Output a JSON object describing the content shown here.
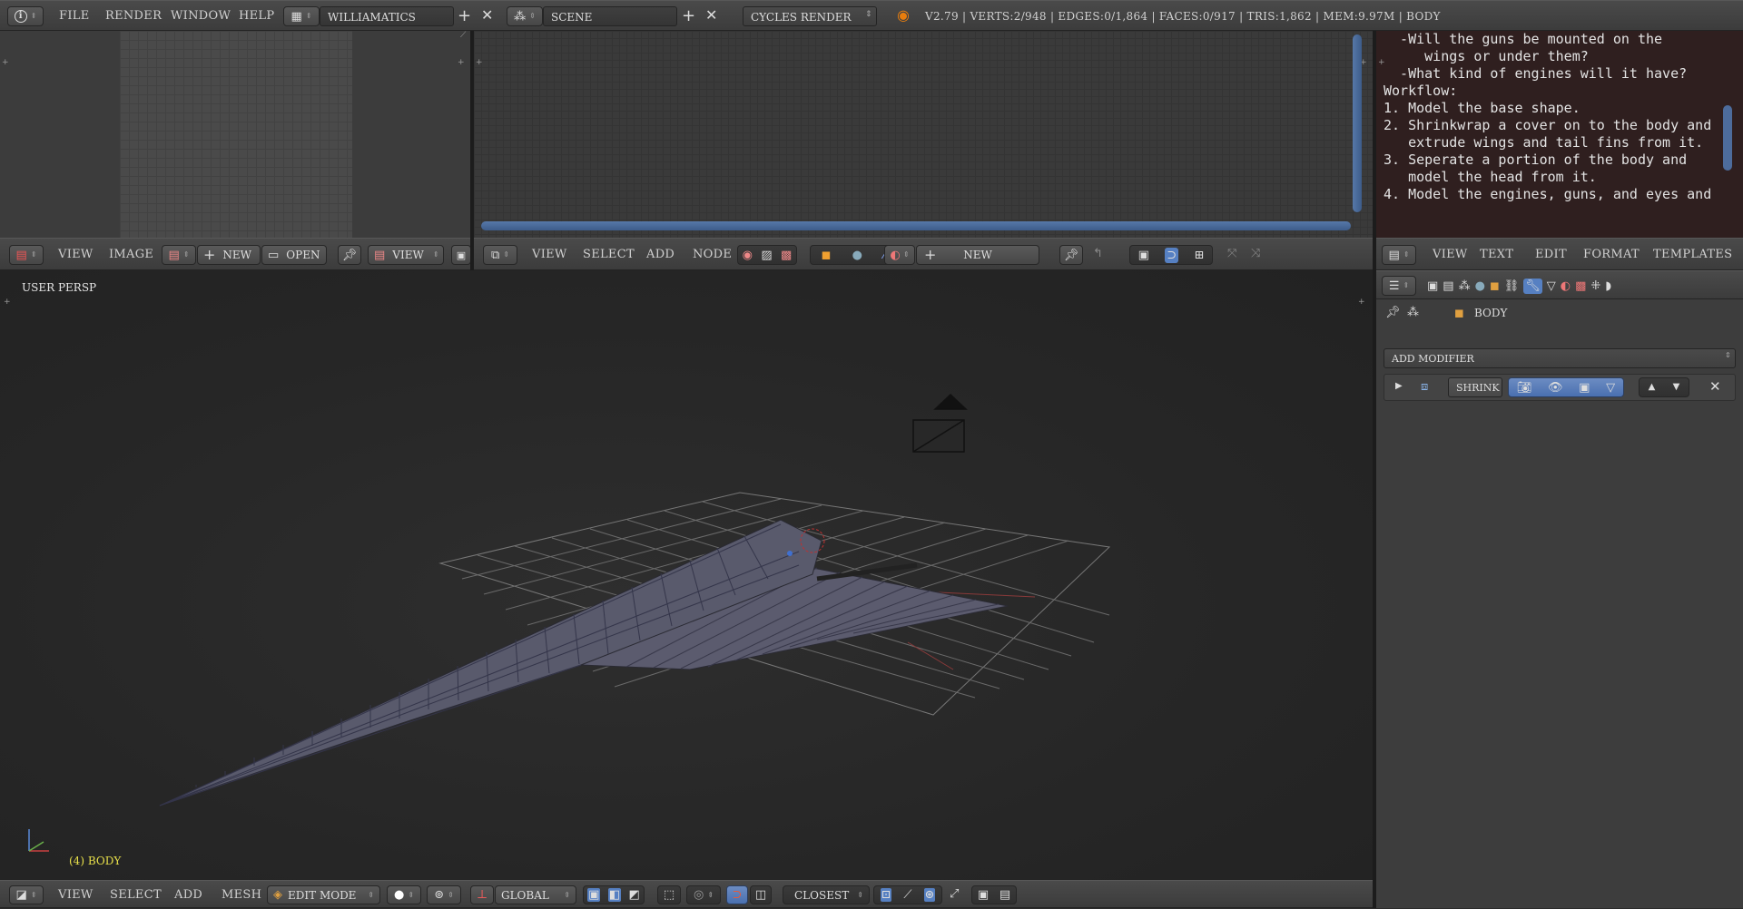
{
  "topbar": {
    "menus": [
      "FILE",
      "RENDER",
      "WINDOW",
      "HELP"
    ],
    "screen_layout": "WILLIAMATICS",
    "scene": "SCENE",
    "render_engine": "CYCLES RENDER",
    "stats": "V2.79 | VERTS:2/948 | EDGES:0/1,864 | FACES:0/917 | TRIS:1,862 | MEM:9.97M | BODY"
  },
  "image_editor": {
    "menus": [
      "VIEW",
      "IMAGE"
    ],
    "new_label": "NEW",
    "open_label": "OPEN",
    "view_label": "VIEW"
  },
  "node_editor": {
    "menus": [
      "VIEW",
      "SELECT",
      "ADD",
      "NODE"
    ],
    "new_label": "NEW"
  },
  "text_editor": {
    "lines": [
      "  -Will the guns be mounted on the",
      "     wings or under them?",
      "  -What kind of engines will it have?",
      "",
      "Workflow:",
      "",
      "1. Model the base shape.",
      "2. Shrinkwrap a cover on to the body and",
      "   extrude wings and tail fins from it.",
      "3. Seperate a portion of the body and",
      "   model the head from it.",
      "4. Model the engines, guns, and eyes and"
    ],
    "menus": [
      "VIEW",
      "TEXT",
      "EDIT",
      "FORMAT",
      "TEMPLATES"
    ]
  },
  "viewport": {
    "view_label": "USER PERSP",
    "object_label": "(4) BODY",
    "menus": [
      "VIEW",
      "SELECT",
      "ADD",
      "MESH"
    ],
    "mode": "EDIT MODE",
    "orientation": "GLOBAL",
    "snap": "CLOSEST"
  },
  "properties": {
    "object_name": "BODY",
    "add_modifier": "ADD MODIFIER",
    "modifier_name": "SHRINK"
  },
  "colors": {
    "accent_blue": "#5680c2",
    "text_bg": "#2f1f1f",
    "viewport_bg": "#262626",
    "object_label": "#e8e04a"
  }
}
